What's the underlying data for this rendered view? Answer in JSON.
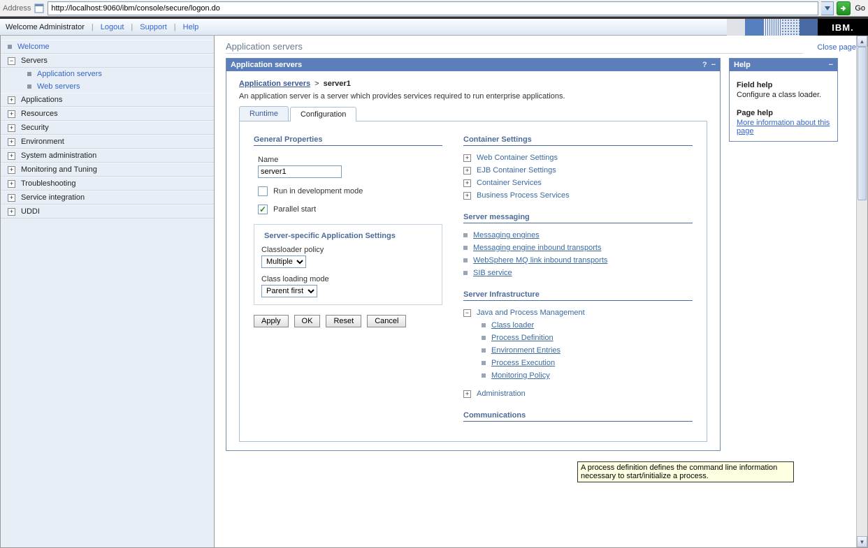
{
  "address": {
    "label": "Address",
    "url": "http://localhost:9060/ibm/console/secure/logon.do",
    "go": "Go"
  },
  "header": {
    "welcome": "Welcome Administrator",
    "logout": "Logout",
    "support": "Support",
    "help": "Help",
    "logo": "IBM."
  },
  "sidebar": {
    "welcome": "Welcome",
    "serversLabel": "Servers",
    "appServers": "Application servers",
    "webServers": "Web servers",
    "items": [
      "Applications",
      "Resources",
      "Security",
      "Environment",
      "System administration",
      "Monitoring and Tuning",
      "Troubleshooting",
      "Service integration",
      "UDDI"
    ]
  },
  "content": {
    "titleSoft": "Application servers",
    "closePage": "Close page",
    "panelTitle": "Application servers",
    "helpTitle": "Help",
    "breadcrumbLink": "Application servers",
    "breadcrumbCur": "server1",
    "desc": "An application server is a server which provides services required to run enterprise applications.",
    "tabRuntime": "Runtime",
    "tabConfig": "Configuration",
    "general": {
      "head": "General Properties",
      "nameLabel": "Name",
      "nameValue": "server1",
      "runDev": "Run in development mode",
      "parallel": "Parallel start"
    },
    "appSettings": {
      "head": "Server-specific Application Settings",
      "classloaderPolicyLabel": "Classloader policy",
      "classloaderPolicyValue": "Multiple",
      "classLoadingModeLabel": "Class loading mode",
      "classLoadingModeValue": "Parent first"
    },
    "buttons": {
      "apply": "Apply",
      "ok": "OK",
      "reset": "Reset",
      "cancel": "Cancel"
    },
    "container": {
      "head": "Container Settings",
      "items": [
        "Web Container Settings",
        "EJB Container Settings",
        "Container Services",
        "Business Process Services"
      ]
    },
    "messaging": {
      "head": "Server messaging",
      "items": [
        "Messaging engines",
        "Messaging engine inbound transports",
        "WebSphere MQ link inbound transports",
        "SIB service"
      ]
    },
    "infra": {
      "head": "Server Infrastructure",
      "group": "Java and Process Management",
      "items": [
        "Class loader",
        "Process Definition",
        "Environment Entries",
        "Process Execution",
        "Monitoring Policy"
      ],
      "admin": "Administration"
    },
    "comm": {
      "head": "Communications"
    }
  },
  "help": {
    "fieldHead": "Field help",
    "fieldText": "Configure a class loader.",
    "pageHead": "Page help",
    "pageLink": "More information about this page"
  },
  "tooltip": "A process definition defines the command line information necessary to start/initialize a process."
}
